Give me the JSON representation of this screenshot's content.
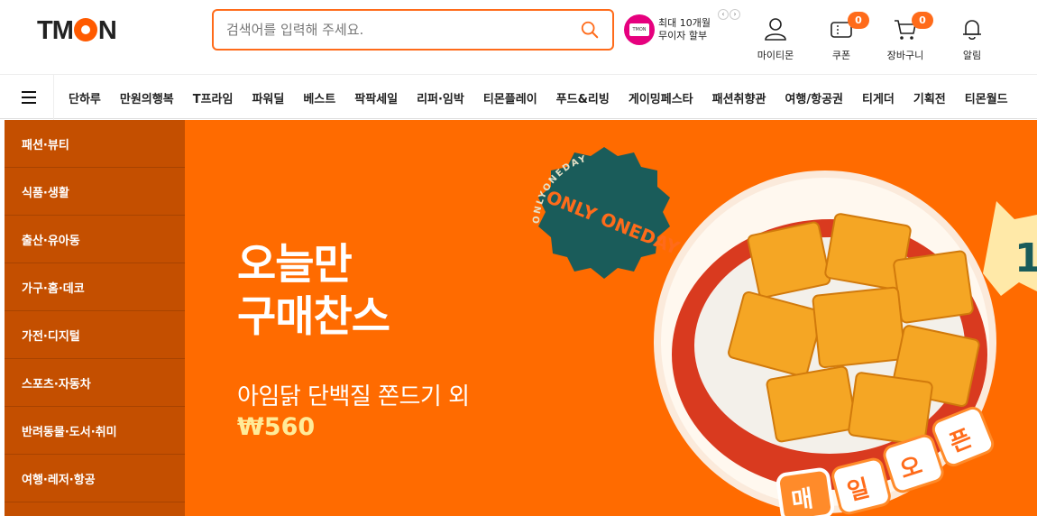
{
  "header": {
    "logo": "TMON",
    "search": {
      "placeholder": "검색어를 입력해 주세요."
    },
    "promo": {
      "line1": "최대 10개월",
      "line2": "무이자 할부",
      "card_text": "TMON"
    },
    "util": [
      {
        "label": "마이티몬",
        "icon": "user-icon"
      },
      {
        "label": "쿠폰",
        "icon": "coupon-icon",
        "badge": "0"
      },
      {
        "label": "장바구니",
        "icon": "cart-icon",
        "badge": "0"
      },
      {
        "label": "알림",
        "icon": "bell-icon"
      }
    ]
  },
  "nav": {
    "menu_icon": "hamburger-icon",
    "items": [
      "단하루",
      "만원의행복",
      "T프라임",
      "파워딜",
      "베스트",
      "팍팍세일",
      "리퍼·임박",
      "티몬플레이",
      "푸드&리빙",
      "게이밍페스타",
      "패션취향관",
      "여행/항공권",
      "티게더",
      "기획전",
      "티몬월드"
    ]
  },
  "sidebar": {
    "categories": [
      "패션·뷰티",
      "식품·생활",
      "출산·유아동",
      "가구·홈·데코",
      "가전·디지털",
      "스포츠·자동차",
      "반려동물·도서·취미",
      "여행·레저·항공"
    ]
  },
  "hero": {
    "title_line1": "오늘만",
    "title_line2": "구매찬스",
    "subtitle": "아임닭 단백질 쫀드기 외",
    "price": "₩560",
    "badge_text": "ONLY ONEDAY",
    "badge_ring": "ONLYONEDAY",
    "daily_open": [
      "매",
      "일",
      "오",
      "픈"
    ],
    "tag_number": "1",
    "colors": {
      "hero_bg": "#ff6b00",
      "sidebar_bg": "#c44f00",
      "accent": "#ff6b1a"
    }
  }
}
